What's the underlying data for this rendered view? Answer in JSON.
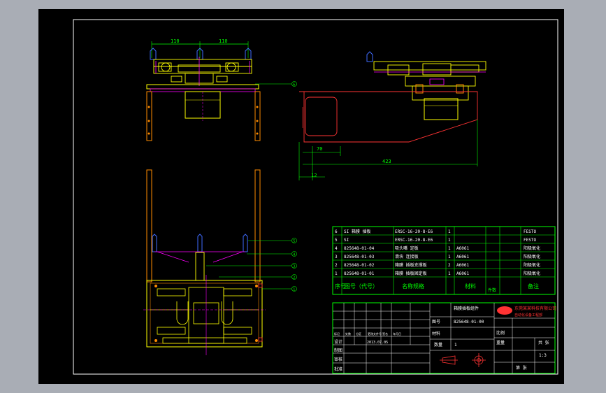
{
  "dimensions": {
    "top_left": "110",
    "top_right": "110",
    "side_70": "70",
    "side_423": "423",
    "side_12": "12"
  },
  "balloons": {
    "b1": "1",
    "b2": "2",
    "b3": "3",
    "b4": "4",
    "b5": "5",
    "b6": "6"
  },
  "bom": {
    "rows": [
      {
        "no": "6",
        "code": "SI 箱膜 插板",
        "spec": "ERSC-16-20-8-E6",
        "qty": "1",
        "material": "",
        "note": "FESTO"
      },
      {
        "no": "5",
        "code": "SI",
        "spec": "ERSC-16-20-8-E6",
        "qty": "1",
        "material": "",
        "note": "FESTO"
      },
      {
        "no": "4",
        "code": "825648-01-04",
        "spec": "吸头嘴 定板",
        "qty": "1",
        "material": "A6061",
        "note": "阳极氧化"
      },
      {
        "no": "3",
        "code": "825648-01-03",
        "spec": "滑块 连接板",
        "qty": "1",
        "material": "A6061",
        "note": "阳极氧化"
      },
      {
        "no": "2",
        "code": "825648-01-02",
        "spec": "箱膜 插板支撑板",
        "qty": "2",
        "material": "A6061",
        "note": "阳极氧化"
      },
      {
        "no": "1",
        "code": "825648-01-01",
        "spec": "箱膜 插板固定板",
        "qty": "1",
        "material": "A6061",
        "note": "阳极氧化"
      }
    ],
    "header": {
      "no": "序号",
      "code": "图号（代号）",
      "spec": "名称规格",
      "qty": "件数",
      "material": "材料",
      "note": "备注"
    }
  },
  "title_block": {
    "company": "东莞某某科技有限公司",
    "company_en": "自动化设备工程部",
    "drawing_name": "箱膜插板组件",
    "drawing_no": "825648-01-00",
    "scale_label": "比例",
    "scale_value": "1:3",
    "qty_label": "数量",
    "qty_value": "1",
    "designer_label": "设计",
    "drawer_label": "制图",
    "checker_label": "审核",
    "approver_label": "批准",
    "date": "2013.07.05",
    "sheet_label": "共 张",
    "sheet_value": "第 张",
    "part_no_label": "图号",
    "material_label": "材料",
    "weight_label": "重量",
    "row_tags": [
      "标记",
      "处数",
      "分区",
      "更改文件号",
      "签名",
      "年月日"
    ]
  }
}
